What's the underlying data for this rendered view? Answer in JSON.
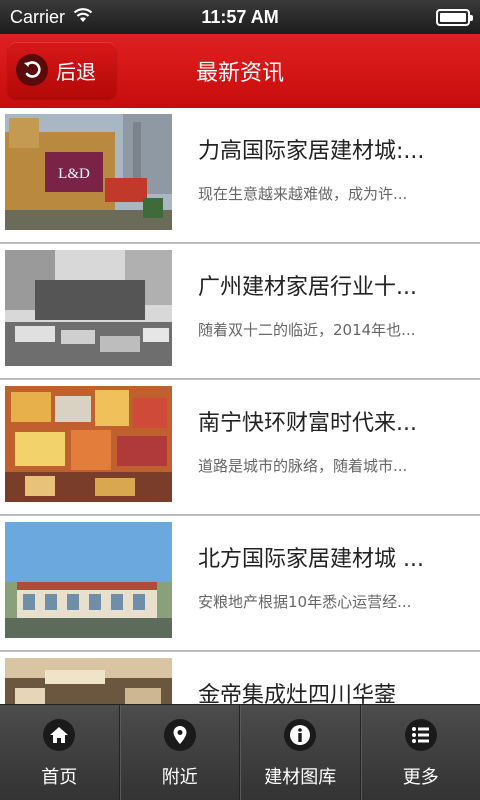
{
  "status_bar": {
    "carrier": "Carrier",
    "time": "11:57 AM",
    "wifi_icon": "wifi-icon",
    "battery_icon": "battery-icon"
  },
  "nav": {
    "back_label": "后退",
    "title": "最新资讯",
    "back_icon": "back-arrow-icon"
  },
  "news": [
    {
      "title": "力高国际家居建材城:...",
      "summary": "现在生意越来越难做，成为许..."
    },
    {
      "title": "广州建材家居行业十...",
      "summary": "随着双十二的临近，2014年也..."
    },
    {
      "title": "南宁快环财富时代来...",
      "summary": "道路是城市的脉络，随着城市..."
    },
    {
      "title": "北方国际家居建材城 ...",
      "summary": "安粮地产根据10年悉心运营经..."
    },
    {
      "title": "金帝集成灶四川华蓥",
      "summary": ""
    }
  ],
  "thumb_text": {
    "ld_sign": "L&D"
  },
  "tabs": [
    {
      "label": "首页",
      "icon": "home-icon"
    },
    {
      "label": "附近",
      "icon": "location-pin-icon"
    },
    {
      "label": "建材图库",
      "icon": "info-icon"
    },
    {
      "label": "更多",
      "icon": "list-icon"
    }
  ],
  "colors": {
    "nav_red": "#d41414",
    "tab_bar": "#3f3f3f",
    "separator": "#bdbdbd"
  }
}
